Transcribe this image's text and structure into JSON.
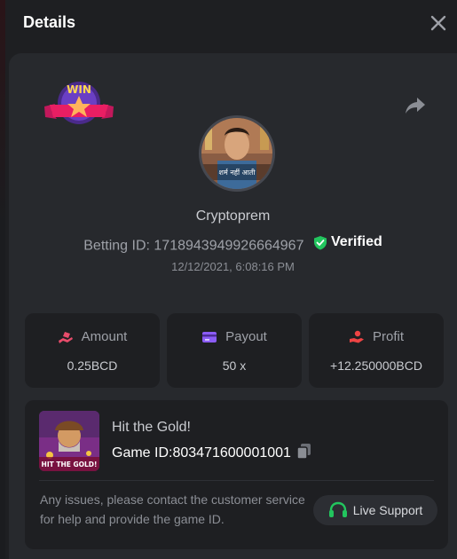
{
  "header": {
    "title": "Details"
  },
  "bet": {
    "badge_text": "WIN",
    "username": "Cryptoprem",
    "betting_id_label": "Betting ID:",
    "betting_id": "1718943949926664967",
    "verified_label": "Verified",
    "datetime": "12/12/2021, 6:08:16 PM",
    "avatar_caption": "शर्म नहीं आती"
  },
  "stats": [
    {
      "label": "Amount",
      "value": "0.25BCD"
    },
    {
      "label": "Payout",
      "value": "50 x"
    },
    {
      "label": "Profit",
      "value": "+12.250000BCD"
    }
  ],
  "game": {
    "name": "Hit the Gold!",
    "id_label": "Game ID:",
    "id": "803471600001001",
    "thumb_text": "HIT THE GOLD!",
    "help_text": "Any issues, please contact the customer service for help and provide the game ID.",
    "support_label": "Live Support"
  },
  "colors": {
    "accent_green": "#22c55e",
    "amount_icon": "#e84c6b",
    "payout_icon": "#8b5cf6",
    "profit_icon": "#ef4444"
  }
}
